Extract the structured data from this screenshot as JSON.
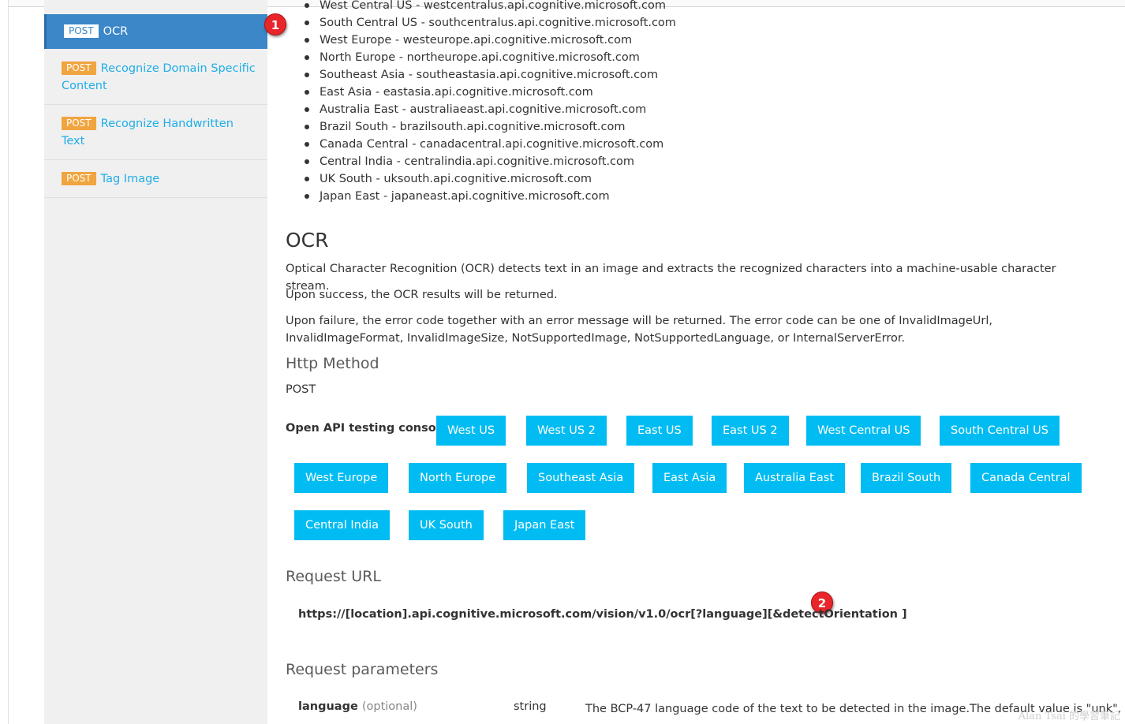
{
  "sidebar": {
    "items": [
      {
        "method": "POST",
        "label": "OCR"
      },
      {
        "method": "POST",
        "label": "Recognize Domain Specific Content"
      },
      {
        "method": "POST",
        "label": "Recognize Handwritten Text"
      },
      {
        "method": "POST",
        "label": "Tag Image"
      }
    ]
  },
  "markers": {
    "one": "1",
    "two": "2"
  },
  "regions_list": [
    "West Central US - westcentralus.api.cognitive.microsoft.com",
    "South Central US - southcentralus.api.cognitive.microsoft.com",
    "West Europe - westeurope.api.cognitive.microsoft.com",
    "North Europe - northeurope.api.cognitive.microsoft.com",
    "Southeast Asia - southeastasia.api.cognitive.microsoft.com",
    "East Asia - eastasia.api.cognitive.microsoft.com",
    "Australia East - australiaeast.api.cognitive.microsoft.com",
    "Brazil South - brazilsouth.api.cognitive.microsoft.com",
    "Canada Central - canadacentral.api.cognitive.microsoft.com",
    "Central India - centralindia.api.cognitive.microsoft.com",
    "UK South - uksouth.api.cognitive.microsoft.com",
    "Japan East - japaneast.api.cognitive.microsoft.com"
  ],
  "ocr": {
    "title": "OCR",
    "desc1": "Optical Character Recognition (OCR) detects text in an image and extracts the recognized characters into a machine-usable character stream.",
    "desc2": "Upon success, the OCR results will be returned.",
    "desc3": "Upon failure, the error code together with an error message will be returned. The error code can be one of InvalidImageUrl, InvalidImageFormat, InvalidImageSize, NotSupportedImage, NotSupportedLanguage, or InternalServerError.",
    "http_method_heading": "Http Method",
    "http_method": "POST"
  },
  "console": {
    "label": "Open API testing console",
    "buttons": [
      "West US",
      "West US 2",
      "East US",
      "East US 2",
      "West Central US",
      "South Central US",
      "West Europe",
      "North Europe",
      "Southeast Asia",
      "East Asia",
      "Australia East",
      "Brazil South",
      "Canada Central",
      "Central India",
      "UK South",
      "Japan East"
    ]
  },
  "request": {
    "url_heading": "Request URL",
    "url": "https://[location].api.cognitive.microsoft.com/vision/v1.0/ocr[?language][&detectOrientation ]",
    "params_heading": "Request parameters",
    "param": {
      "name": "language",
      "optional": "(optional)",
      "type": "string",
      "desc": "The BCP-47 language code of the text to be detected in the image.The default value is \"unk\", then"
    }
  },
  "watermark": "Alan Tsai 的學習筆記"
}
